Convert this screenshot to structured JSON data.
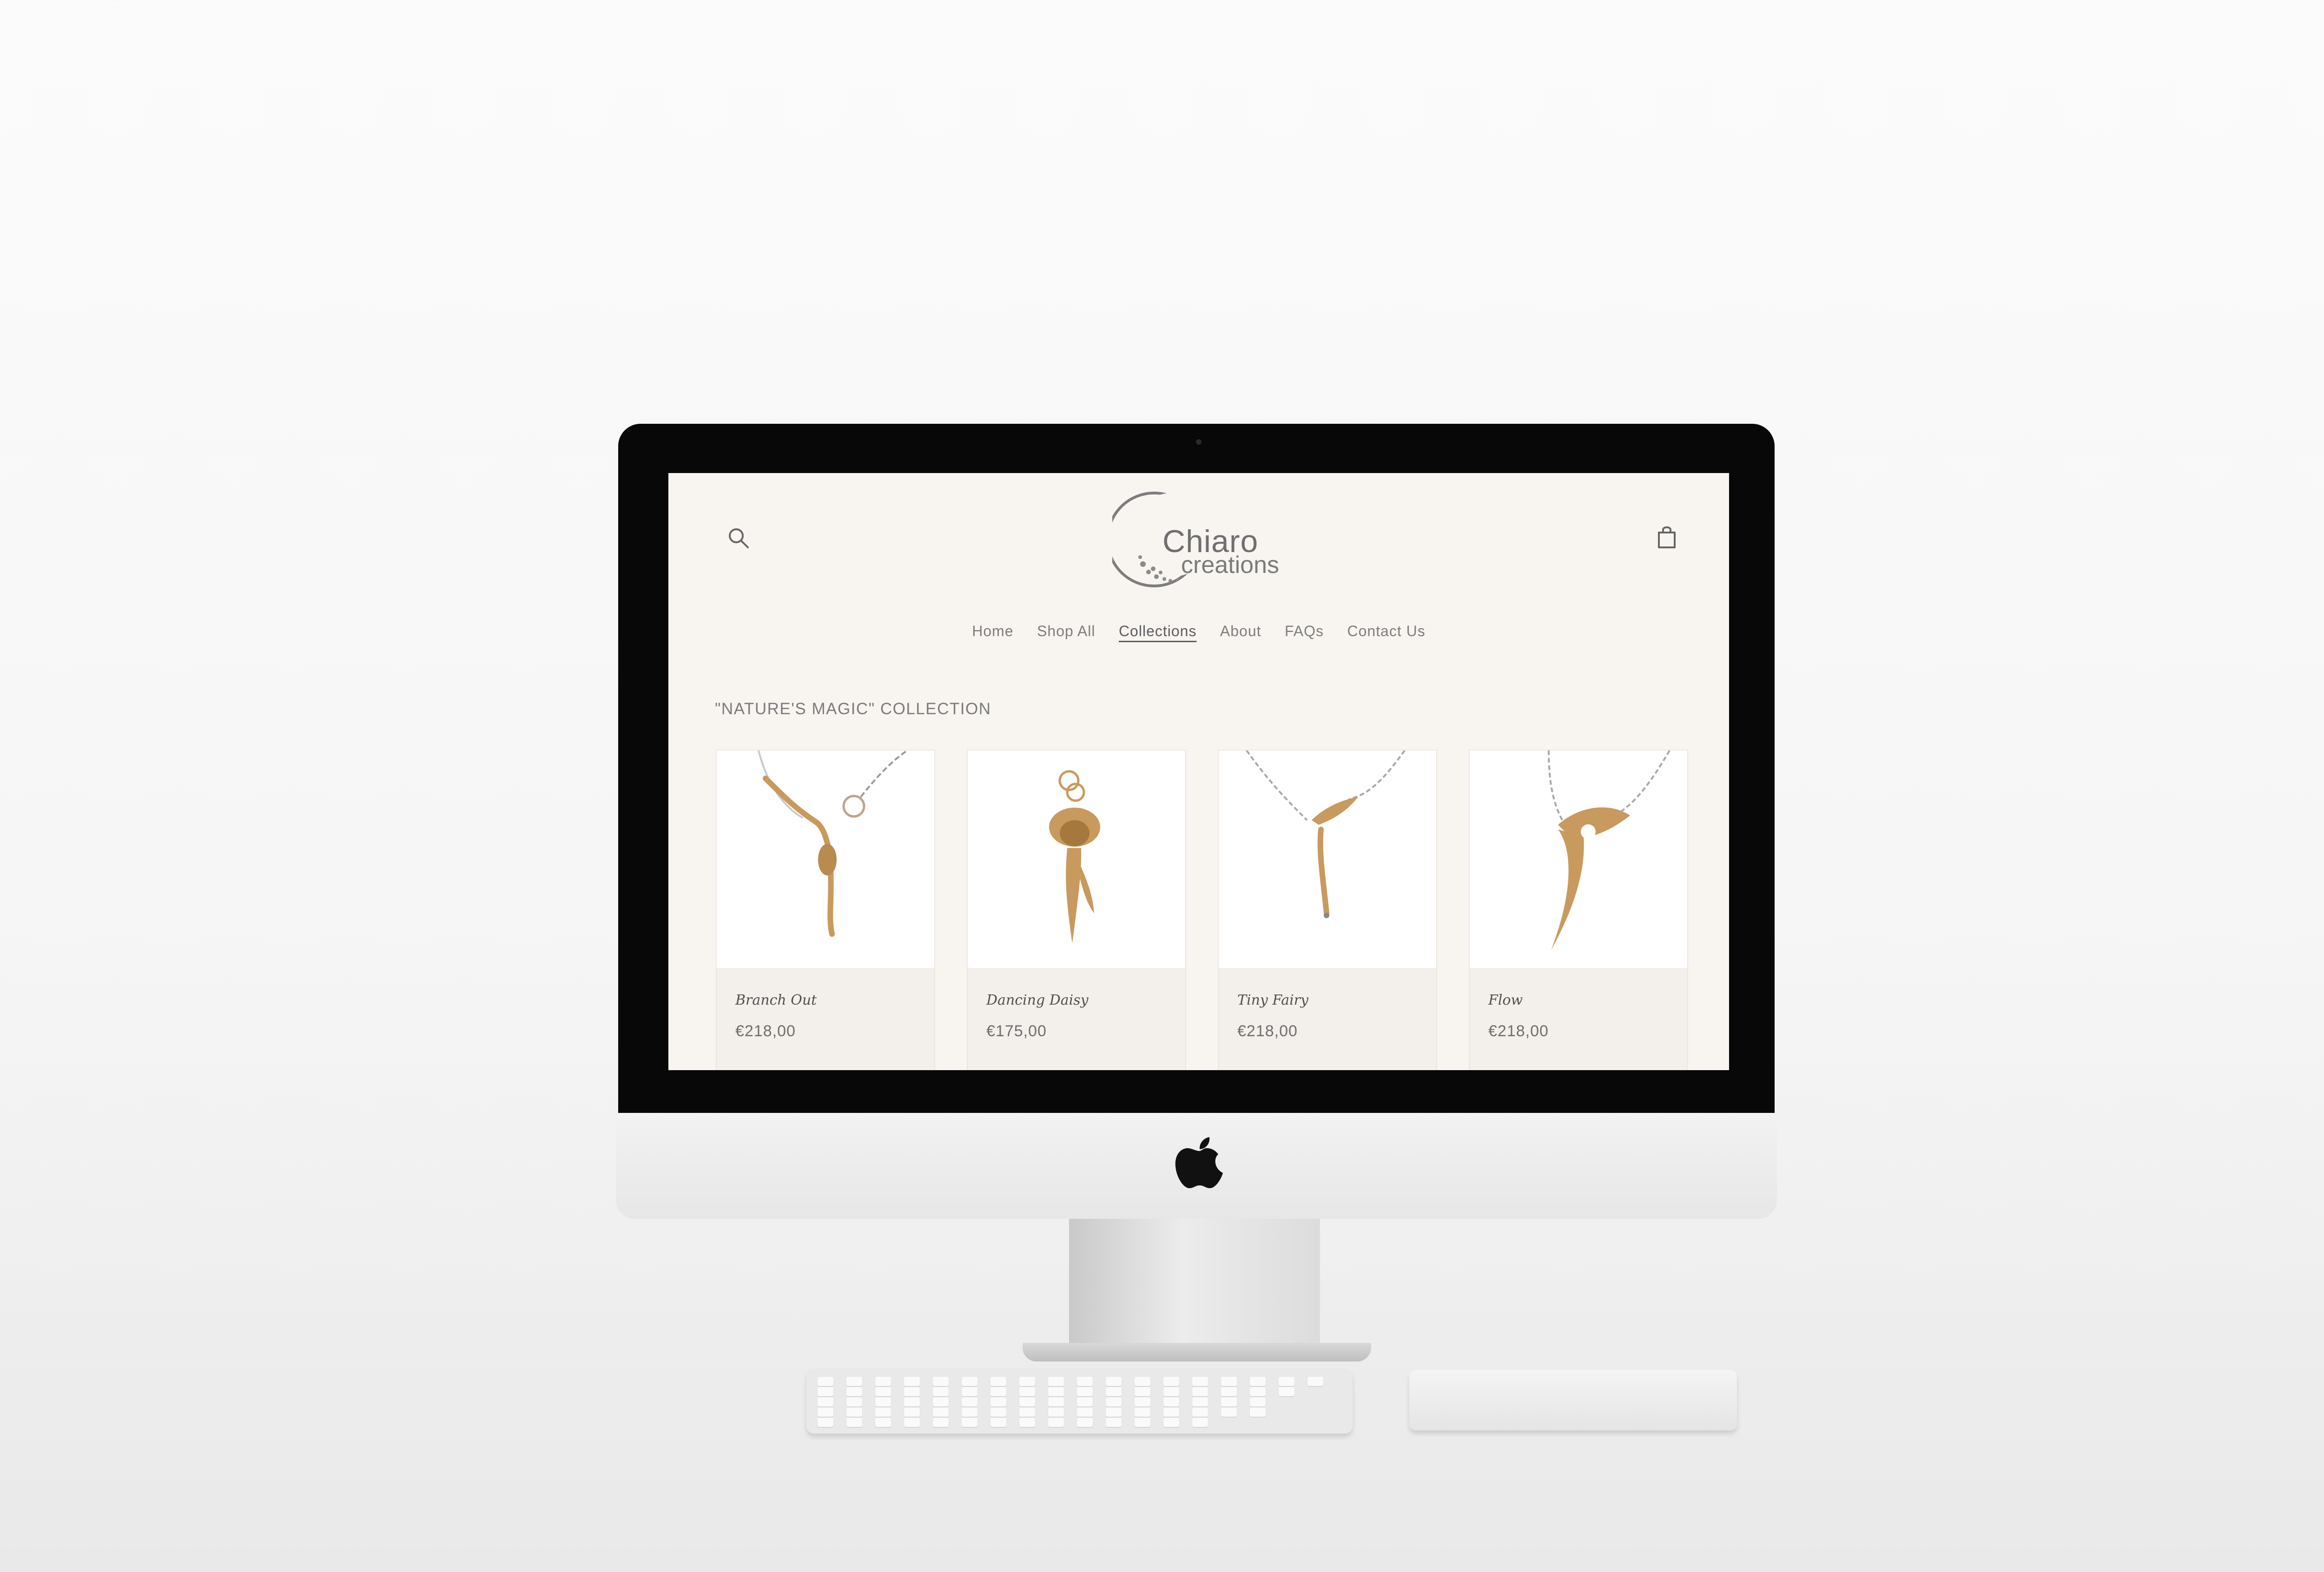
{
  "site": {
    "logo": {
      "line1": "Chiaro",
      "line2": "creations"
    },
    "nav": [
      "Home",
      "Shop All",
      "Collections",
      "About",
      "FAQs",
      "Contact Us"
    ],
    "active_nav": "Collections",
    "collection_title": "\"NATURE'S MAGIC\" COLLECTION",
    "products": [
      {
        "name": "Branch Out",
        "price": "€218,00",
        "image": "pendant-necklace-branch-icon"
      },
      {
        "name": "Dancing Daisy",
        "price": "€175,00",
        "image": "pendant-necklace-daisy-icon"
      },
      {
        "name": "Tiny Fairy",
        "price": "€218,00",
        "image": "pendant-necklace-fairy-icon"
      },
      {
        "name": "Flow",
        "price": "€218,00",
        "image": "pendant-necklace-flow-icon"
      }
    ]
  },
  "colors": {
    "page_bg": "#f8f5f1",
    "card_bg": "#f3efea",
    "gold": "#c89a5d",
    "text": "#6f6f6f"
  }
}
